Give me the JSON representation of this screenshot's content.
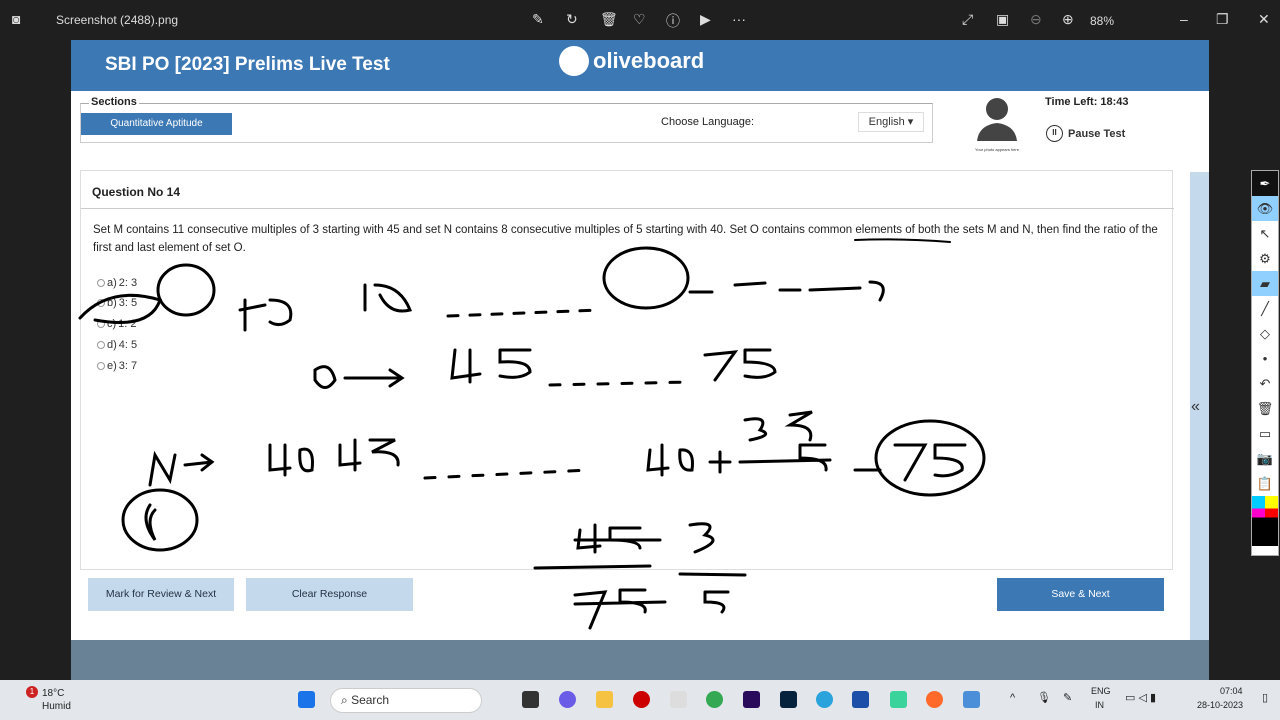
{
  "viewer": {
    "filename": "Screenshot (2488).png",
    "zoom": "88%",
    "icons": [
      "edit-icon",
      "rotate-icon",
      "delete-icon",
      "heart-icon",
      "info-icon",
      "slideshow-icon",
      "more-icon",
      "expand-icon",
      "fit-icon",
      "zoom-out-icon",
      "zoom-in-icon"
    ]
  },
  "header": {
    "title": "SBI PO [2023] Prelims Live Test",
    "logo": "oliveboard",
    "color": "#3c78b4"
  },
  "sections": {
    "legend": "Sections",
    "active": "Quantitative Aptitude",
    "language_label": "Choose Language:",
    "language": "English"
  },
  "candidate": {
    "photo_caption": "Your photo appears here",
    "time_left": "Time Left: 18:43",
    "pause": "Pause Test"
  },
  "question": {
    "number": "Question No 14",
    "text": "Set M contains 11 consecutive multiples of 3 starting with 45 and set N contains 8 consecutive multiples of 5 starting with 40. Set O contains common elements of both the sets M and N, then find the ratio of the first and last element of set O.",
    "options": [
      {
        "key": "a)",
        "label": "2: 3"
      },
      {
        "key": "b)",
        "label": "3: 5"
      },
      {
        "key": "c)",
        "label": "1: 2"
      },
      {
        "key": "d)",
        "label": "4: 5"
      },
      {
        "key": "e)",
        "label": "3: 7"
      }
    ]
  },
  "buttons": {
    "mark_review": "Mark for Review & Next",
    "clear": "Clear Response",
    "save_next": "Save & Next"
  },
  "taskbar": {
    "weather_temp": "18°C",
    "weather_desc": "Humid",
    "weather_badge": "1",
    "search": "Search",
    "lang1": "ENG",
    "lang2": "IN",
    "time": "07:04",
    "date": "28-10-2023"
  }
}
